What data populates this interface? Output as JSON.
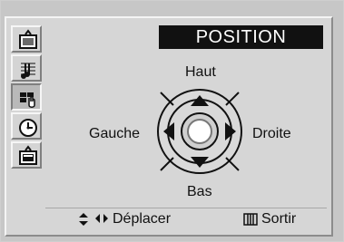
{
  "header": {
    "title": "POSITION"
  },
  "controls": {
    "up_label": "Haut",
    "left_label": "Gauche",
    "right_label": "Droite",
    "down_label": "Bas"
  },
  "footer": {
    "move_label": "Déplacer",
    "exit_label": "Sortir"
  },
  "sidebar": {
    "items": [
      {
        "name": "tv-picture-icon"
      },
      {
        "name": "music-note-icon"
      },
      {
        "name": "hand-select-icon",
        "active": true
      },
      {
        "name": "clock-icon"
      },
      {
        "name": "channel-list-icon"
      }
    ]
  },
  "colors": {
    "background": "#d6d6d6",
    "title_bg": "#111111",
    "title_fg": "#ffffff"
  }
}
